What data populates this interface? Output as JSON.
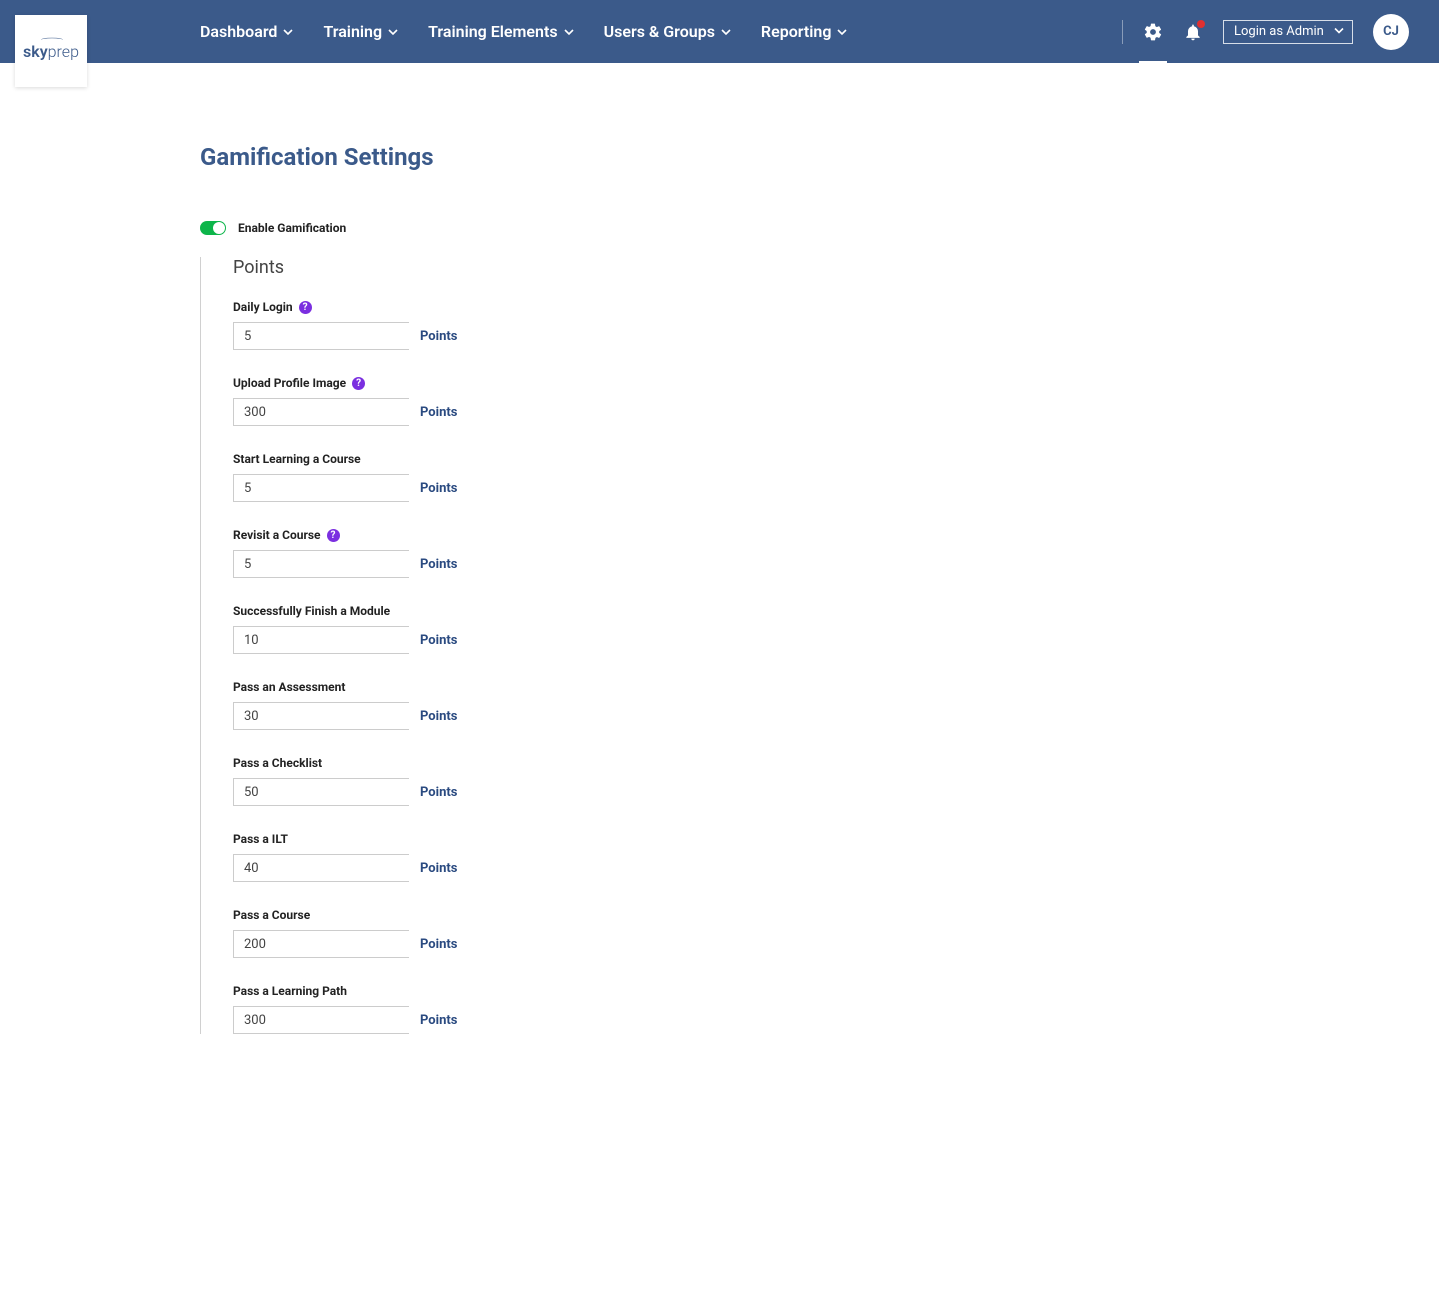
{
  "logo": {
    "part1": "sky",
    "part2": "prep"
  },
  "nav": {
    "dashboard": "Dashboard",
    "training": "Training",
    "training_elements": "Training Elements",
    "users_groups": "Users & Groups",
    "reporting": "Reporting"
  },
  "header": {
    "login_as": "Login as Admin",
    "avatar_initials": "CJ"
  },
  "page": {
    "title": "Gamification Settings",
    "enable_label": "Enable Gamification",
    "section_points_title": "Points",
    "points_suffix": "Points",
    "help_glyph": "?"
  },
  "fields": {
    "daily_login": {
      "label": "Daily Login",
      "value": "5",
      "help": true
    },
    "upload_profile": {
      "label": "Upload Profile Image",
      "value": "300",
      "help": true
    },
    "start_learning": {
      "label": "Start Learning a Course",
      "value": "5",
      "help": false
    },
    "revisit_course": {
      "label": "Revisit a Course",
      "value": "5",
      "help": true
    },
    "finish_module": {
      "label": "Successfully Finish a Module",
      "value": "10",
      "help": false
    },
    "pass_assessment": {
      "label": "Pass an Assessment",
      "value": "30",
      "help": false
    },
    "pass_checklist": {
      "label": "Pass a Checklist",
      "value": "50",
      "help": false
    },
    "pass_ilt": {
      "label": "Pass a ILT",
      "value": "40",
      "help": false
    },
    "pass_course": {
      "label": "Pass a Course",
      "value": "200",
      "help": false
    },
    "pass_learning_path": {
      "label": "Pass a Learning Path",
      "value": "300",
      "help": false
    }
  }
}
